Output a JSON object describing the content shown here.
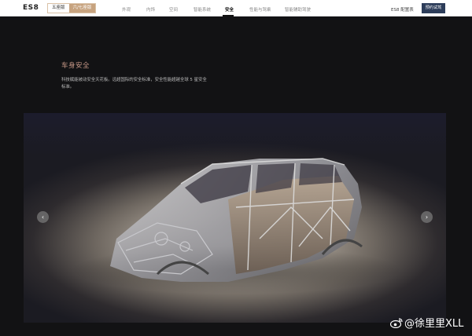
{
  "header": {
    "logo": "ES8",
    "toggle": [
      "五座版",
      "六/七座版"
    ],
    "nav": [
      "外观",
      "内饰",
      "空间",
      "智能系统",
      "安全",
      "性能与驾乘",
      "智能辅助驾驶"
    ],
    "active_nav": "安全",
    "config_link": "ES8 配置表",
    "test_drive": "预约试驾"
  },
  "section": {
    "title": "车身安全",
    "description": "科技赋能被动安全天花板。远超国际的安全标准，安全性能超越全球 5 星安全标准。"
  },
  "carousel": {
    "prev_icon": "‹",
    "next_icon": "›"
  },
  "watermark": {
    "text": "@徐里里XLL"
  },
  "colors": {
    "accent_title": "#c99a89",
    "button_bg": "#2d3d5a",
    "toggle_active": "#c7a37f"
  }
}
